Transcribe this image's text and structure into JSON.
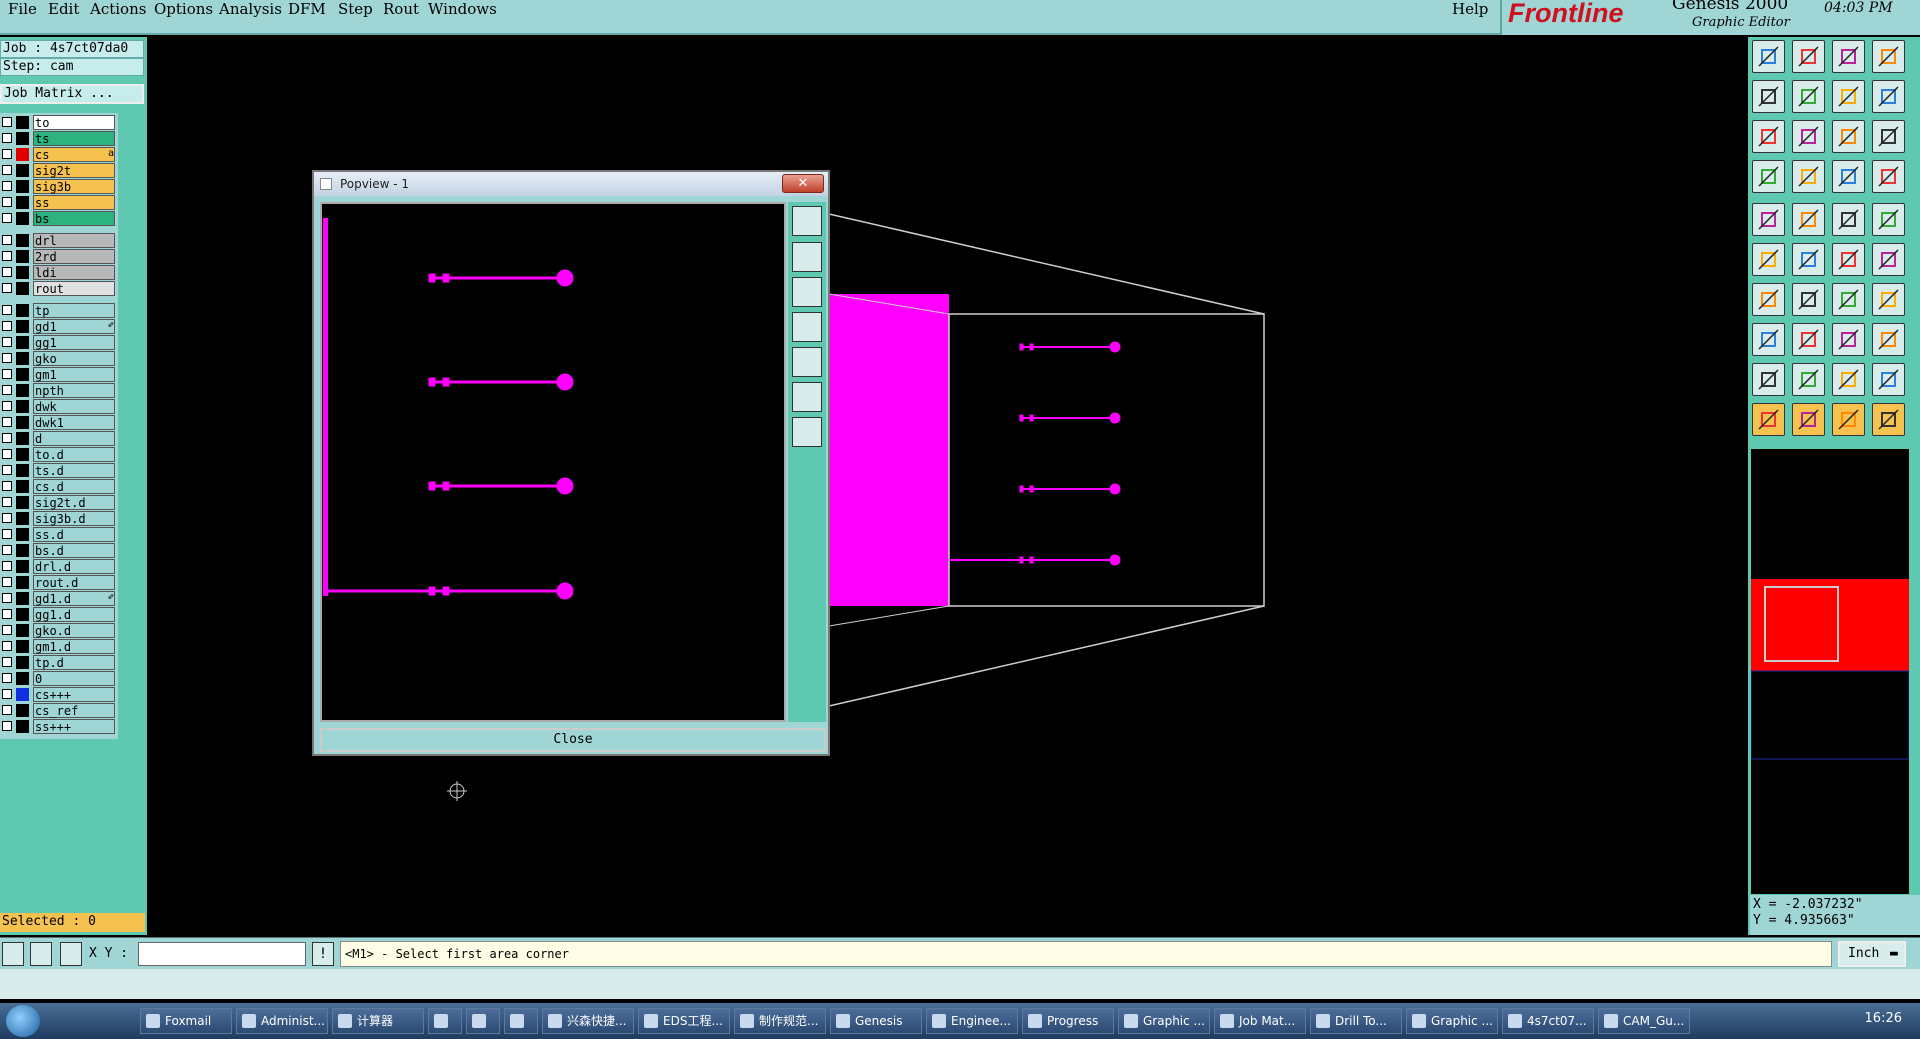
{
  "menu": {
    "items": [
      "File",
      "Edit",
      "Actions",
      "Options",
      "Analysis",
      "DFM",
      "Step",
      "Rout",
      "Windows"
    ],
    "help": "Help"
  },
  "brand": {
    "logo": "Frontline",
    "product": "Genesis 2000",
    "subtitle": "Graphic Editor",
    "time": "04:03 PM"
  },
  "job": {
    "job_label": "Job : 4s7ct07da0",
    "step_label": "Step: cam",
    "matrix_button": "Job Matrix ..."
  },
  "layers": [
    {
      "name": "to",
      "color": "#ffffff",
      "swatch": "#000000",
      "mark": ""
    },
    {
      "name": "ts",
      "color": "#2db37f",
      "swatch": "#000000",
      "mark": ""
    },
    {
      "name": "cs",
      "color": "#f5c250",
      "swatch": "#e10000",
      "mark": "a",
      "checked": true
    },
    {
      "name": "sig2t",
      "color": "#f5c250",
      "swatch": "#000000",
      "mark": ""
    },
    {
      "name": "sig3b",
      "color": "#f5c250",
      "swatch": "#000000",
      "mark": ""
    },
    {
      "name": "ss",
      "color": "#f5c250",
      "swatch": "#000000",
      "mark": ""
    },
    {
      "name": "bs",
      "color": "#2db37f",
      "swatch": "#000000",
      "mark": ""
    },
    {
      "name": "drl",
      "color": "#b8b8b8",
      "swatch": "#000000",
      "mark": ""
    },
    {
      "name": "2rd",
      "color": "#b8b8b8",
      "swatch": "#000000",
      "mark": ""
    },
    {
      "name": "ldi",
      "color": "#b8b8b8",
      "swatch": "#000000",
      "mark": ""
    },
    {
      "name": "rout",
      "color": "#e0e0e0",
      "swatch": "#000000",
      "mark": ""
    },
    {
      "name": "tp",
      "color": "#9fd5d5",
      "swatch": "#000000",
      "mark": ""
    },
    {
      "name": "gd1",
      "color": "#9fd5d5",
      "swatch": "#000000",
      "mark": "✐"
    },
    {
      "name": "gg1",
      "color": "#9fd5d5",
      "swatch": "#000000",
      "mark": ""
    },
    {
      "name": "gko",
      "color": "#9fd5d5",
      "swatch": "#000000",
      "mark": ""
    },
    {
      "name": "gm1",
      "color": "#9fd5d5",
      "swatch": "#000000",
      "mark": ""
    },
    {
      "name": "npth",
      "color": "#9fd5d5",
      "swatch": "#000000",
      "mark": ""
    },
    {
      "name": "dwk",
      "color": "#9fd5d5",
      "swatch": "#000000",
      "mark": ""
    },
    {
      "name": "dwk1",
      "color": "#9fd5d5",
      "swatch": "#000000",
      "mark": ""
    },
    {
      "name": "d",
      "color": "#9fd5d5",
      "swatch": "#000000",
      "mark": ""
    },
    {
      "name": "to.d",
      "color": "#9fd5d5",
      "swatch": "#000000",
      "mark": ""
    },
    {
      "name": "ts.d",
      "color": "#9fd5d5",
      "swatch": "#000000",
      "mark": ""
    },
    {
      "name": "cs.d",
      "color": "#9fd5d5",
      "swatch": "#000000",
      "mark": ""
    },
    {
      "name": "sig2t.d",
      "color": "#9fd5d5",
      "swatch": "#000000",
      "mark": ""
    },
    {
      "name": "sig3b.d",
      "color": "#9fd5d5",
      "swatch": "#000000",
      "mark": ""
    },
    {
      "name": "ss.d",
      "color": "#9fd5d5",
      "swatch": "#000000",
      "mark": ""
    },
    {
      "name": "bs.d",
      "color": "#9fd5d5",
      "swatch": "#000000",
      "mark": ""
    },
    {
      "name": "drl.d",
      "color": "#9fd5d5",
      "swatch": "#000000",
      "mark": ""
    },
    {
      "name": "rout.d",
      "color": "#9fd5d5",
      "swatch": "#000000",
      "mark": ""
    },
    {
      "name": "gd1.d",
      "color": "#9fd5d5",
      "swatch": "#000000",
      "mark": "✐"
    },
    {
      "name": "gg1.d",
      "color": "#9fd5d5",
      "swatch": "#000000",
      "mark": ""
    },
    {
      "name": "gko.d",
      "color": "#9fd5d5",
      "swatch": "#000000",
      "mark": ""
    },
    {
      "name": "gm1.d",
      "color": "#9fd5d5",
      "swatch": "#000000",
      "mark": ""
    },
    {
      "name": "tp.d",
      "color": "#9fd5d5",
      "swatch": "#000000",
      "mark": ""
    },
    {
      "name": "0",
      "color": "#9fd5d5",
      "swatch": "#000000",
      "mark": ""
    },
    {
      "name": "cs+++",
      "color": "#9fd5d5",
      "swatch": "#1030e0",
      "mark": ""
    },
    {
      "name": "cs_ref",
      "color": "#9fd5d5",
      "swatch": "#000000",
      "mark": ""
    },
    {
      "name": "ss+++",
      "color": "#9fd5d5",
      "swatch": "#000000",
      "mark": ""
    }
  ],
  "selected": "Selected : 0",
  "popview": {
    "title": "Popview - 1",
    "close_button": "Close"
  },
  "coords": {
    "x": "X = -2.037232\"",
    "y": "Y = 4.935663\""
  },
  "command": {
    "xy_label": "X Y :",
    "xy_value": "",
    "prompt": "<M1> - Select first area corner",
    "units": "Inch"
  },
  "taskbar": {
    "items": [
      "Foxmail",
      "Administ...",
      "计算器",
      "",
      "",
      "",
      "兴森快捷...",
      "EDS工程...",
      "制作规范...",
      "Genesis",
      "Enginee...",
      "Progress",
      "Graphic ...",
      "Job Mat...",
      "Drill To...",
      "Graphic ...",
      "4s7ct07...",
      "CAM_Gu..."
    ],
    "clock": "16:26"
  },
  "colors": {
    "accent": "#ff00ff",
    "panel": "#5ec9b0",
    "menubar": "#9fd5d5",
    "selection": "#e10000"
  }
}
